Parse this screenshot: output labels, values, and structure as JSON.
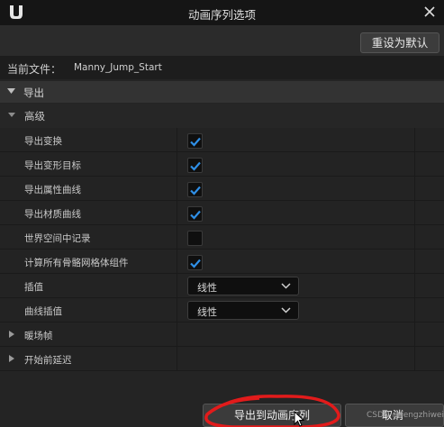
{
  "window": {
    "title": "动画序列选项"
  },
  "toolbar": {
    "reset_label": "重设为默认"
  },
  "file": {
    "label": "当前文件：",
    "name": "Manny_Jump_Start"
  },
  "sections": {
    "export": "导出",
    "advanced": "高级"
  },
  "options": [
    {
      "label": "导出变换",
      "checked": true
    },
    {
      "label": "导出变形目标",
      "checked": true
    },
    {
      "label": "导出属性曲线",
      "checked": true
    },
    {
      "label": "导出材质曲线",
      "checked": true
    },
    {
      "label": "世界空间中记录",
      "checked": false
    },
    {
      "label": "计算所有骨骼网格体组件",
      "checked": true
    }
  ],
  "dropdowns": [
    {
      "label": "插值",
      "value": "线性"
    },
    {
      "label": "曲线插值",
      "value": "线性"
    }
  ],
  "collapsed": [
    {
      "label": "暖场帧"
    },
    {
      "label": "开始前延迟"
    }
  ],
  "footer": {
    "export_label": "导出到动画序列",
    "cancel_label": "取消",
    "watermark": "CSDN @fengzhiwei"
  },
  "colors": {
    "checkmark": "#2f8fe6",
    "annotation": "#e21b1b"
  }
}
